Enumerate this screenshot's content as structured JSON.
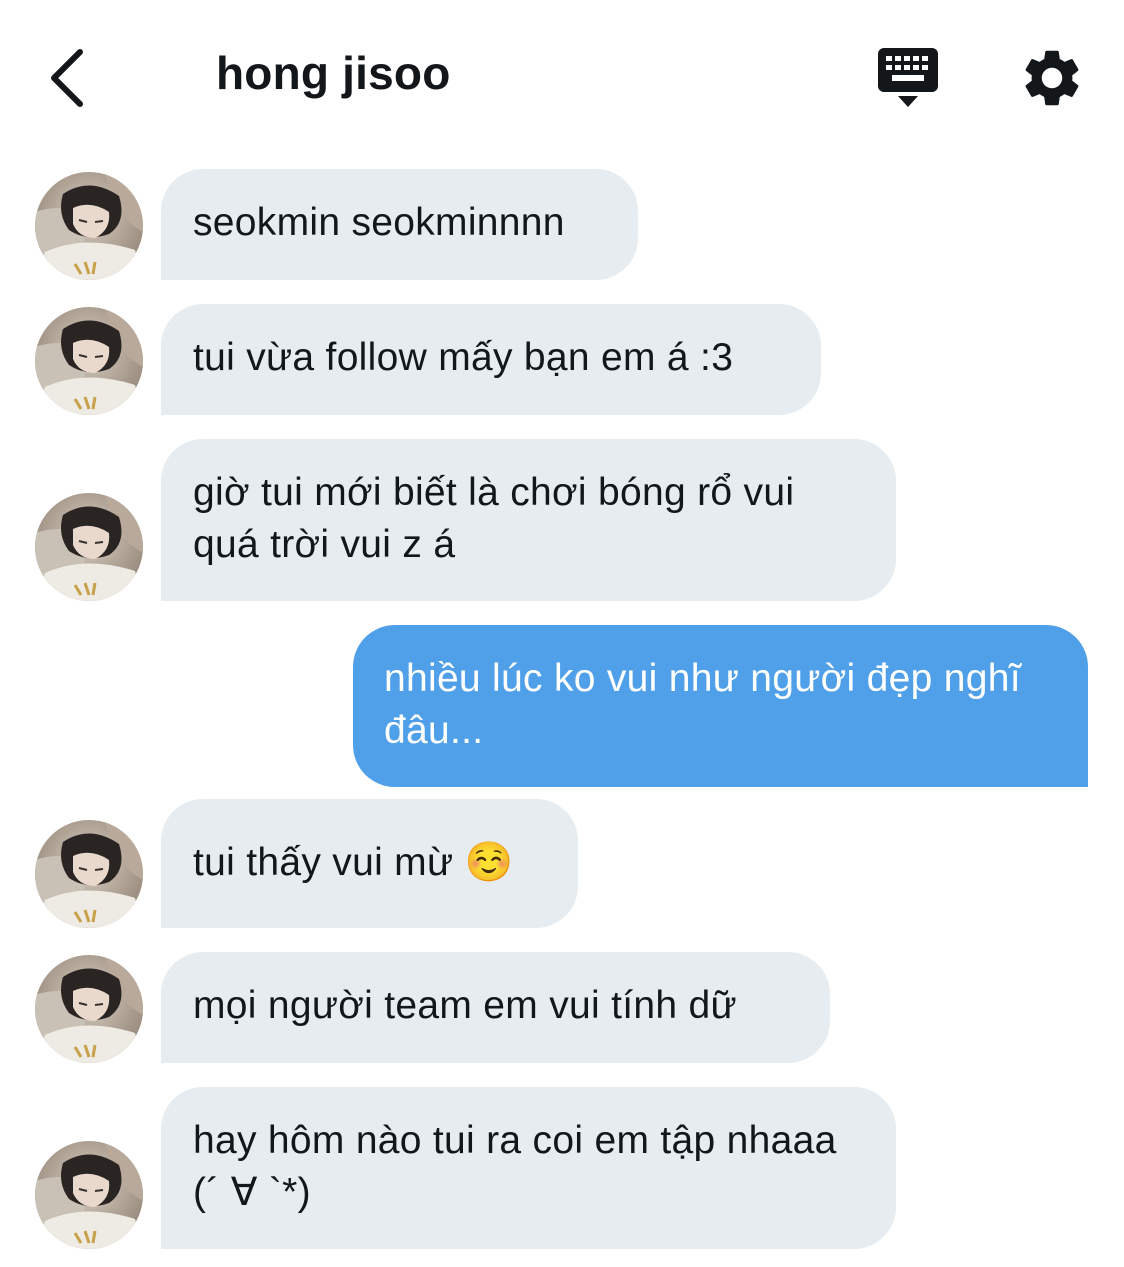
{
  "header": {
    "title": "hong jisoo",
    "back_icon": "chevron-left-icon",
    "keyboard_icon": "keyboard-icon",
    "settings_icon": "gear-icon"
  },
  "colors": {
    "incoming_bubble": "#e6ecf0",
    "outgoing_bubble": "#4fa0e9",
    "text": "#14171a"
  },
  "messages": [
    {
      "direction": "in",
      "text": "seokmin seokminnnn"
    },
    {
      "direction": "in",
      "text": "tui vừa follow mấy bạn em á :3"
    },
    {
      "direction": "in",
      "text": "giờ tui mới biết là chơi bóng rổ vui quá trời vui z á"
    },
    {
      "direction": "out",
      "text": "nhiều lúc ko vui như người đẹp nghĩ đâu..."
    },
    {
      "direction": "in",
      "text": "tui thấy vui mừ ☺️"
    },
    {
      "direction": "in",
      "text": "mọi người team em vui tính dữ"
    },
    {
      "direction": "in",
      "text": "hay hôm nào tui ra coi em tập nhaaa (´ ∀ `*)"
    }
  ]
}
